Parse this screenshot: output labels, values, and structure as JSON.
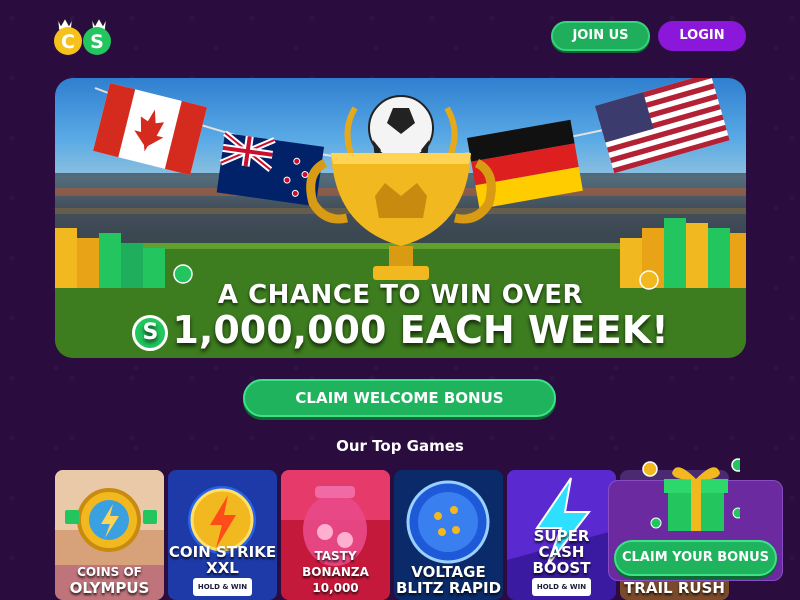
{
  "header": {
    "logo_letters": [
      "C",
      "S"
    ],
    "join_label": "JOIN US",
    "login_label": "LOGIN"
  },
  "hero": {
    "line1": "A CHANCE TO WIN OVER",
    "line2": "1,000,000 EACH WEEK!",
    "coin_symbol": "S",
    "flags": [
      "canada-flag",
      "new-zealand-flag",
      "germany-flag",
      "usa-flag"
    ]
  },
  "cta": {
    "claim_label": "CLAIM WELCOME BONUS"
  },
  "top_games": {
    "title": "Our Top Games",
    "games": [
      {
        "line1": "COINS OF",
        "line2": "OLYMPUS",
        "badge": ""
      },
      {
        "line1": "COIN STRIKE",
        "line2": "XXL",
        "badge": "HOLD & WIN"
      },
      {
        "line1": "TASTY BONANZA",
        "line2": "10,000",
        "badge": ""
      },
      {
        "line1": "VOLTAGE",
        "line2": "BLITZ RAPID",
        "badge": ""
      },
      {
        "line1": "SUPER",
        "line2": "CASH BOOST",
        "badge": "HOLD & WIN"
      },
      {
        "line1": "",
        "line2": "TRAIL RUSH",
        "badge": ""
      }
    ]
  },
  "bonus_popup": {
    "button_label": "CLAIM YOUR BONUS"
  },
  "colors": {
    "background": "#2a0d3e",
    "green": "#1fb35e",
    "purple": "#8a17d9",
    "gold": "#f2b81f"
  }
}
